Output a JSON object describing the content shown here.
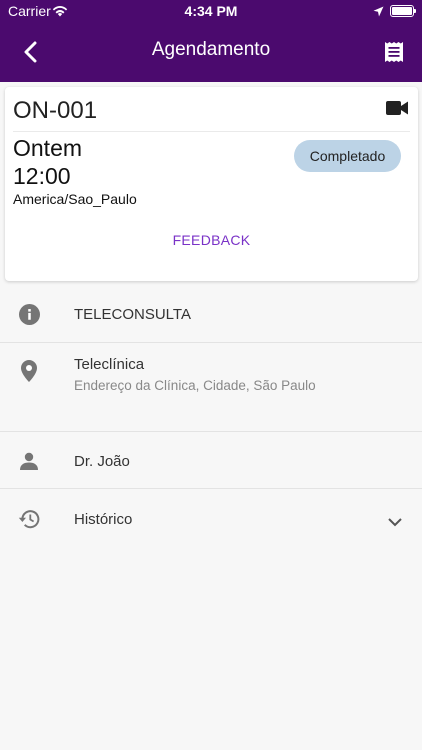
{
  "status_bar": {
    "carrier": "Carrier",
    "time": "4:34 PM"
  },
  "nav": {
    "title": "Agendamento",
    "back_icon": "chevron-left-icon",
    "action_icon": "receipt-icon"
  },
  "appointment": {
    "code": "ON-001",
    "type_icon": "video-camera-icon",
    "day": "Ontem",
    "time": "12:00",
    "timezone": "America/Sao_Paulo",
    "status": "Completado",
    "status_color": "#bcd3e6",
    "feedback_label": "FEEDBACK",
    "accent": "#7a32c7"
  },
  "details": {
    "type": {
      "icon": "info-icon",
      "label": "TELECONSULTA"
    },
    "location": {
      "icon": "location-pin-icon",
      "name": "Teleclínica",
      "address": "Endereço da Clínica, Cidade, São Paulo"
    },
    "doctor": {
      "icon": "person-icon",
      "name": "Dr. João"
    },
    "history": {
      "icon": "history-icon",
      "label": "Histórico",
      "expand_icon": "chevron-down-icon"
    }
  },
  "colors": {
    "header": "#4b0a6e"
  }
}
